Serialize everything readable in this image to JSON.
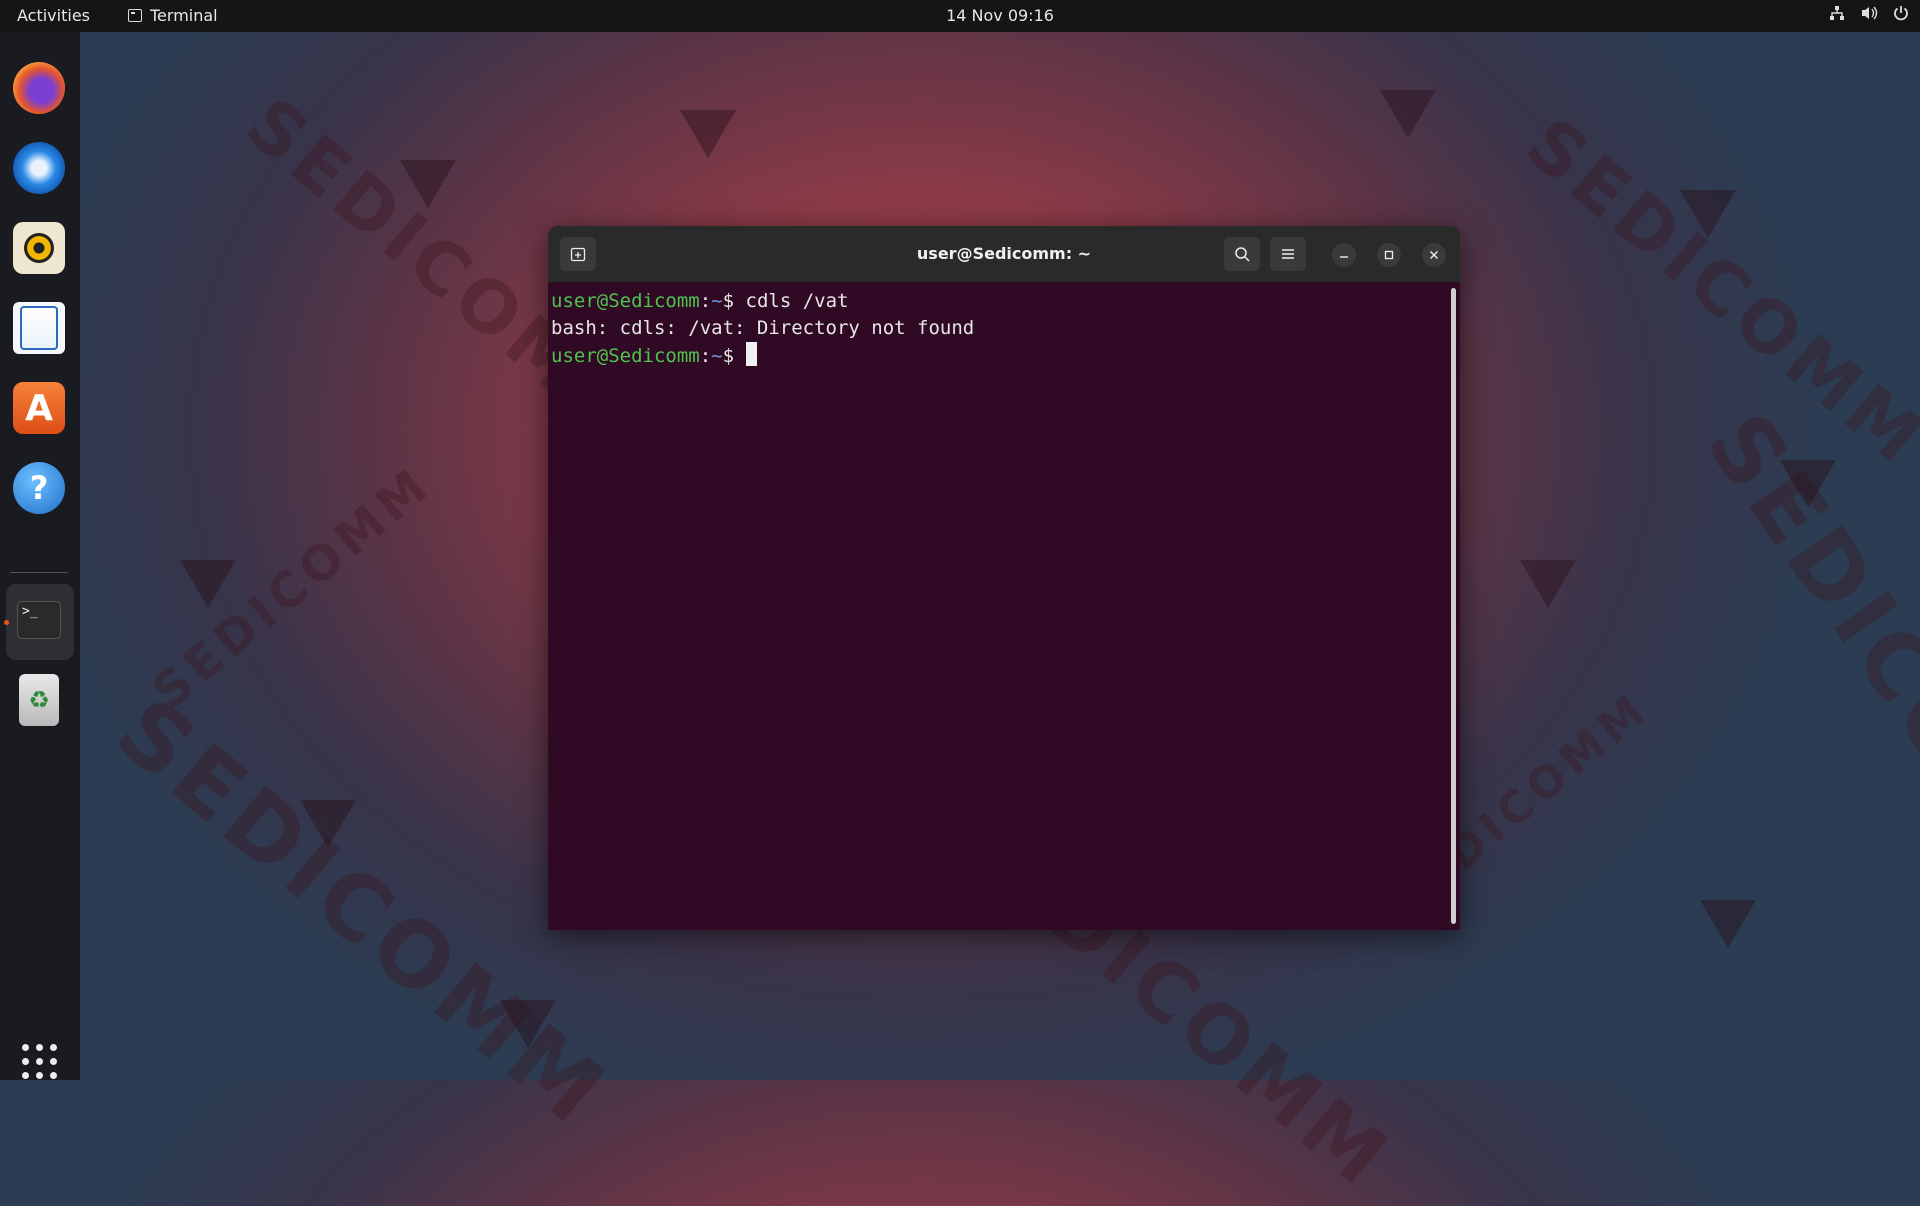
{
  "topbar": {
    "activities": "Activities",
    "app_name": "Terminal",
    "clock": "14 Nov  09:16"
  },
  "wallpaper": {
    "watermark_text": "SEDICOMM"
  },
  "dock": {
    "items": [
      {
        "name": "firefox-icon"
      },
      {
        "name": "thunderbird-icon"
      },
      {
        "name": "rhythmbox-icon"
      },
      {
        "name": "libreoffice-writer-icon"
      },
      {
        "name": "app-center-icon",
        "glyph": "A"
      },
      {
        "name": "help-icon",
        "glyph": "?"
      },
      {
        "name": "terminal-icon",
        "glyph": ">_"
      },
      {
        "name": "trash-icon",
        "glyph": "♻"
      }
    ],
    "running_indicator_color": "#e95420"
  },
  "terminal": {
    "title": "user@Sedicomm: ~",
    "background": "#300a24",
    "lines": [
      {
        "user": "user@Sedicomm",
        "sep": ":",
        "path": "~",
        "sigil": "$ ",
        "cmd": "cdls /vat"
      },
      {
        "output": "bash: cdls: /vat: Directory not found"
      },
      {
        "user": "user@Sedicomm",
        "sep": ":",
        "path": "~",
        "sigil": "$ ",
        "cmd": ""
      }
    ]
  },
  "colors": {
    "prompt_user": "#4ec34e",
    "prompt_path": "#6f9fe0",
    "accent": "#e95420"
  }
}
